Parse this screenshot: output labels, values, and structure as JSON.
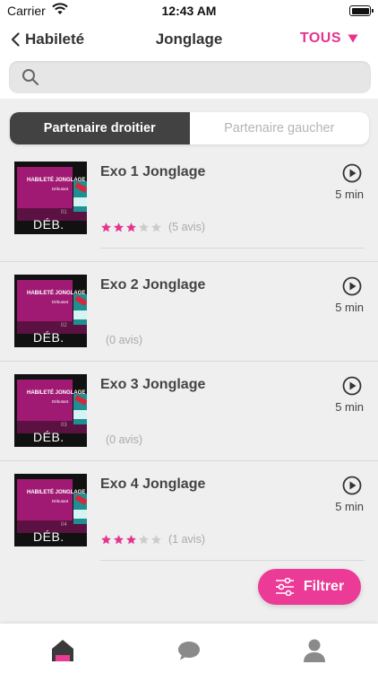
{
  "status_bar": {
    "carrier": "Carrier",
    "time": "12:43 AM"
  },
  "nav": {
    "back_label": "Habileté",
    "title": "Jonglage",
    "filter_label": "TOUS"
  },
  "search": {
    "placeholder": "",
    "value": ""
  },
  "segments": [
    {
      "label": "Partenaire droitier",
      "active": true
    },
    {
      "label": "Partenaire gaucher",
      "active": false
    }
  ],
  "thumbnail": {
    "title": "HABILETÉ JONGLAGE",
    "subtitle": "Débutant",
    "level": "DÉB."
  },
  "exercises": [
    {
      "number": "01",
      "title": "Exo 1 Jonglage",
      "duration": "5 min",
      "rating": 3,
      "max_rating": 5,
      "reviews": "(5 avis)"
    },
    {
      "number": "02",
      "title": "Exo 2 Jonglage",
      "duration": "5 min",
      "rating": 0,
      "max_rating": 5,
      "reviews": "(0 avis)"
    },
    {
      "number": "03",
      "title": "Exo 3 Jonglage",
      "duration": "5 min",
      "rating": 0,
      "max_rating": 5,
      "reviews": "(0 avis)"
    },
    {
      "number": "04",
      "title": "Exo 4 Jonglage",
      "duration": "5 min",
      "rating": 3,
      "max_rating": 5,
      "reviews": "(1 avis)"
    }
  ],
  "filter_button": {
    "label": "Filtrer"
  },
  "tabs": [
    {
      "icon": "home-icon",
      "active": true
    },
    {
      "icon": "chat-icon",
      "active": false
    },
    {
      "icon": "profile-icon",
      "active": false
    }
  ],
  "colors": {
    "accent": "#ec3a97",
    "active_segment": "#424242",
    "star_filled": "#e6338f",
    "star_empty": "#cccccc"
  }
}
